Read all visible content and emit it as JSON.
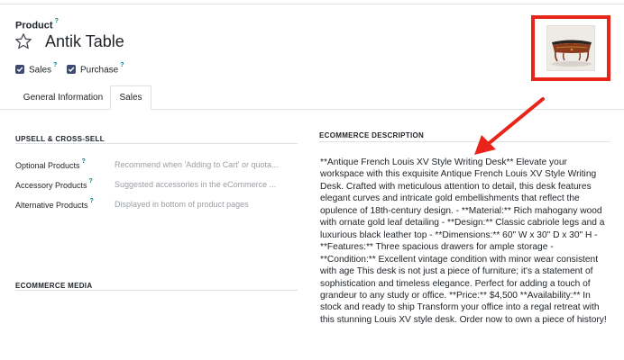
{
  "product": {
    "field_label": "Product",
    "help_mark": "?",
    "name": "Antik Table",
    "sales_label": "Sales",
    "purchase_label": "Purchase"
  },
  "tabs": [
    {
      "label": "General Information"
    },
    {
      "label": "Sales"
    }
  ],
  "upsell": {
    "title": "UPSELL & CROSS-SELL",
    "rows": [
      {
        "label": "Optional Products",
        "placeholder": "Recommend when 'Adding to Cart' or quota..."
      },
      {
        "label": "Accessory Products",
        "placeholder": "Suggested accessories in the eCommerce ..."
      },
      {
        "label": "Alternative Products",
        "placeholder": "Displayed in bottom of product pages"
      }
    ]
  },
  "ecommerce_media": {
    "title": "ECOMMERCE MEDIA"
  },
  "ecommerce_description": {
    "title": "ECOMMERCE DESCRIPTION",
    "text": "**Antique French Louis XV Style Writing Desk** Elevate your workspace with this exquisite Antique French Louis XV Style Writing Desk. Crafted with meticulous attention to detail, this desk features elegant curves and intricate gold embellishments that reflect the opulence of 18th-century design. - **Material:** Rich mahogany wood with ornate gold leaf detailing - **Design:** Classic cabriole legs and a luxurious black leather top - **Dimensions:** 60\" W x 30\" D x 30\" H - **Features:** Three spacious drawers for ample storage - **Condition:** Excellent vintage condition with minor wear consistent with age This desk is not just a piece of furniture; it's a statement of sophistication and timeless elegance. Perfect for adding a touch of grandeur to any study or office. **Price:** $4,500 **Availability:** In stock and ready to ship Transform your office into a regal retreat with this stunning Louis XV style desk. Order now to own a piece of history!"
  },
  "colors": {
    "annotation": "#e8241a",
    "checkbox": "#3d4a73",
    "help_mark": "#017e84",
    "placeholder": "#9a9ea3"
  }
}
